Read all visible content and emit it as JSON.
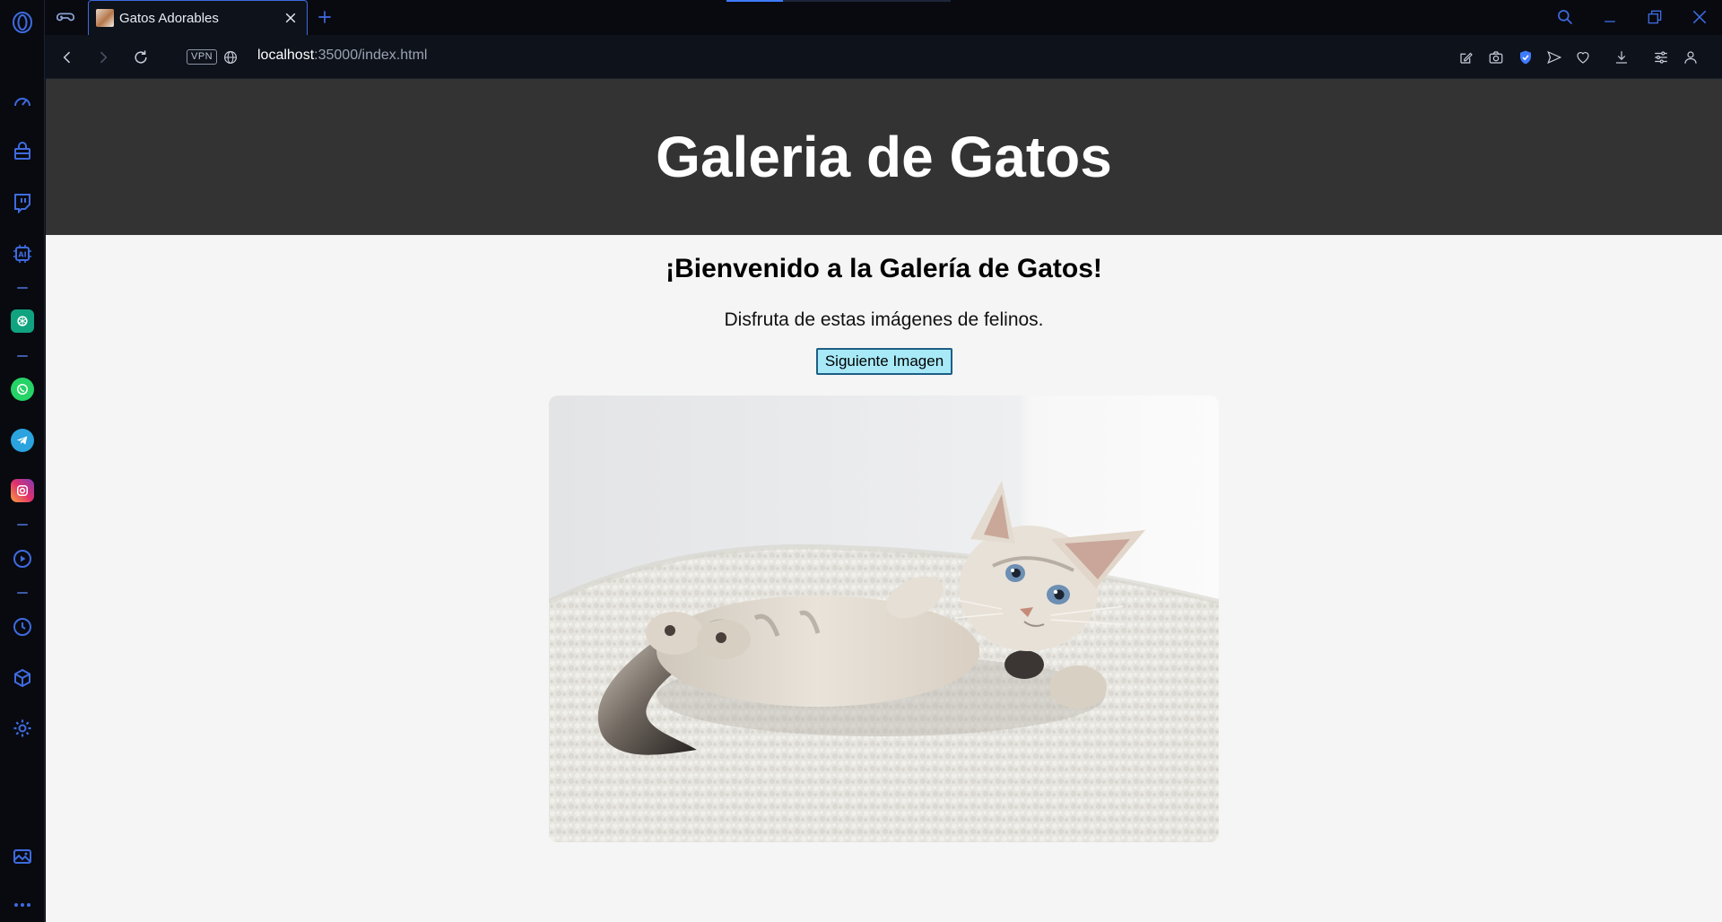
{
  "browser": {
    "tab": {
      "title": "Gatos Adorables"
    },
    "address": {
      "vpn_label": "VPN",
      "url_host": "localhost",
      "url_rest": ":35000/index.html"
    },
    "load_progress": 0.25,
    "accent_color": "#3f6be0"
  },
  "sidebar": {
    "items": [
      {
        "icon": "opera-logo-icon"
      },
      {
        "icon": "speed-dial-icon"
      },
      {
        "icon": "shopping-bag-icon"
      },
      {
        "icon": "twitch-icon"
      },
      {
        "icon": "ai-chip-icon"
      },
      {
        "icon": "chatgpt-icon"
      },
      {
        "icon": "whatsapp-icon"
      },
      {
        "icon": "telegram-icon"
      },
      {
        "icon": "instagram-icon"
      },
      {
        "icon": "player-icon"
      },
      {
        "icon": "history-icon"
      },
      {
        "icon": "extensions-cube-icon"
      },
      {
        "icon": "settings-gear-icon"
      },
      {
        "icon": "gallery-icon"
      },
      {
        "icon": "more-icon"
      }
    ]
  },
  "page": {
    "header_title": "Galeria de Gatos",
    "welcome_heading": "¡Bienvenido a la Galería de Gatos!",
    "subtitle": "Disfruta de estas imágenes de felinos.",
    "next_button_label": "Siguiente Imagen",
    "header_bg": "#333333",
    "button_bg": "#a7e9f7"
  }
}
